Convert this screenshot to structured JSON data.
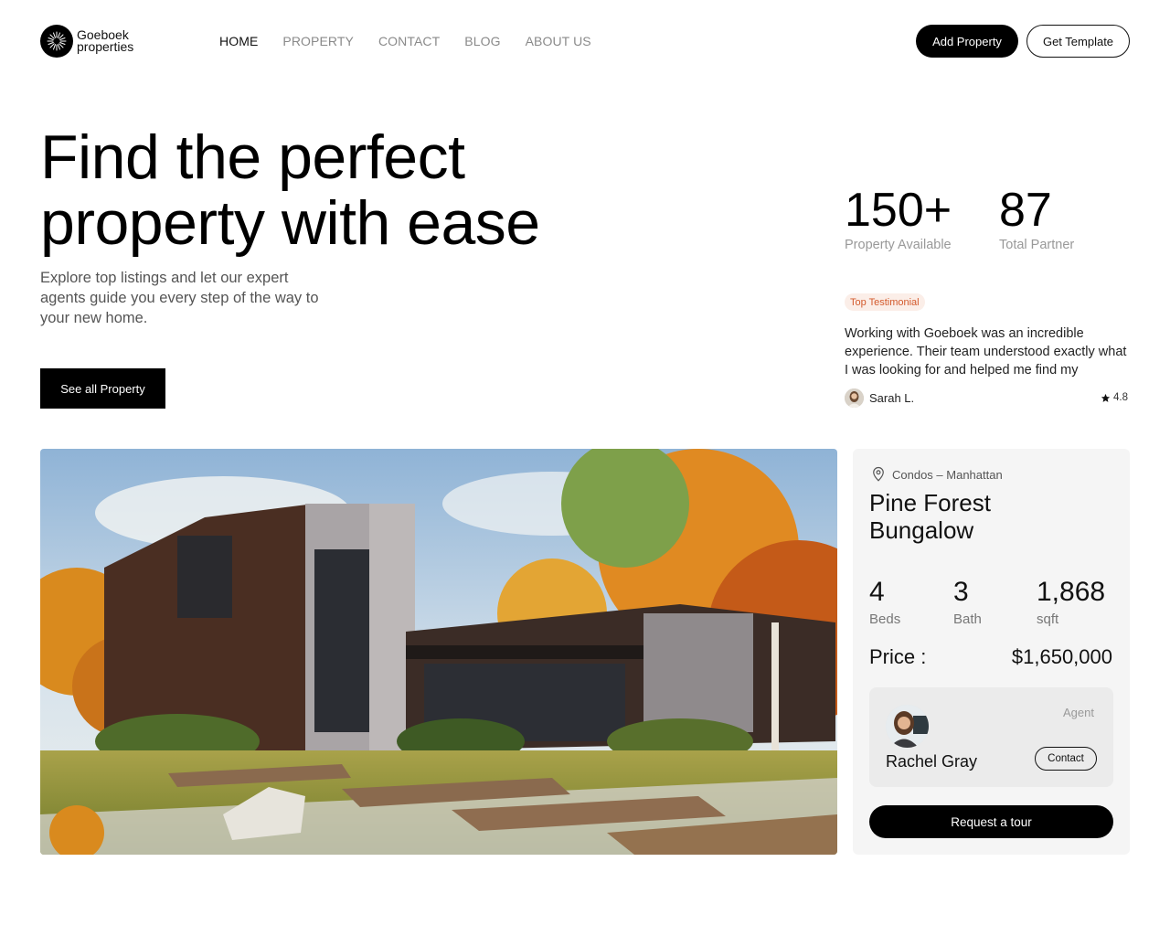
{
  "header": {
    "logo_line1": "Goeboek",
    "logo_line2": "properties",
    "nav": [
      {
        "label": "HOME",
        "active": true
      },
      {
        "label": "PROPERTY"
      },
      {
        "label": "CONTACT"
      },
      {
        "label": "BLOG"
      },
      {
        "label": "ABOUT US"
      }
    ],
    "add_property_label": "Add Property",
    "get_template_label": "Get Template"
  },
  "hero": {
    "title_line1": "Find the perfect",
    "title_line2": "property with ease",
    "subtitle": "Explore top listings and let our expert agents guide you every step of the way to your new home.",
    "cta_label": "See all Property"
  },
  "stats": [
    {
      "value": "150+",
      "label": "Property Available"
    },
    {
      "value": "87",
      "label": "Total Partner"
    }
  ],
  "testimonial": {
    "badge": "Top Testimonial",
    "quote": "Working with Goeboek was an incredible experience. Their team understood exactly what I was looking for and helped me find my",
    "author": "Sarah L.",
    "rating": "4.8"
  },
  "listing": {
    "location": "Condos – Manhattan",
    "title": "Pine Forest Bungalow",
    "specs": [
      {
        "value": "4",
        "label": "Beds"
      },
      {
        "value": "3",
        "label": "Bath"
      },
      {
        "value": "1,868",
        "label": "sqft"
      }
    ],
    "price_label": "Price :",
    "price_value": "$1,650,000",
    "agent_role": "Agent",
    "agent_name": "Rachel Gray",
    "contact_label": "Contact",
    "tour_label": "Request a tour"
  },
  "colors": {
    "primary": "#000000",
    "badge_text": "#d35a2c",
    "badge_bg": "#fbeee8",
    "card_bg": "#f5f5f5"
  }
}
